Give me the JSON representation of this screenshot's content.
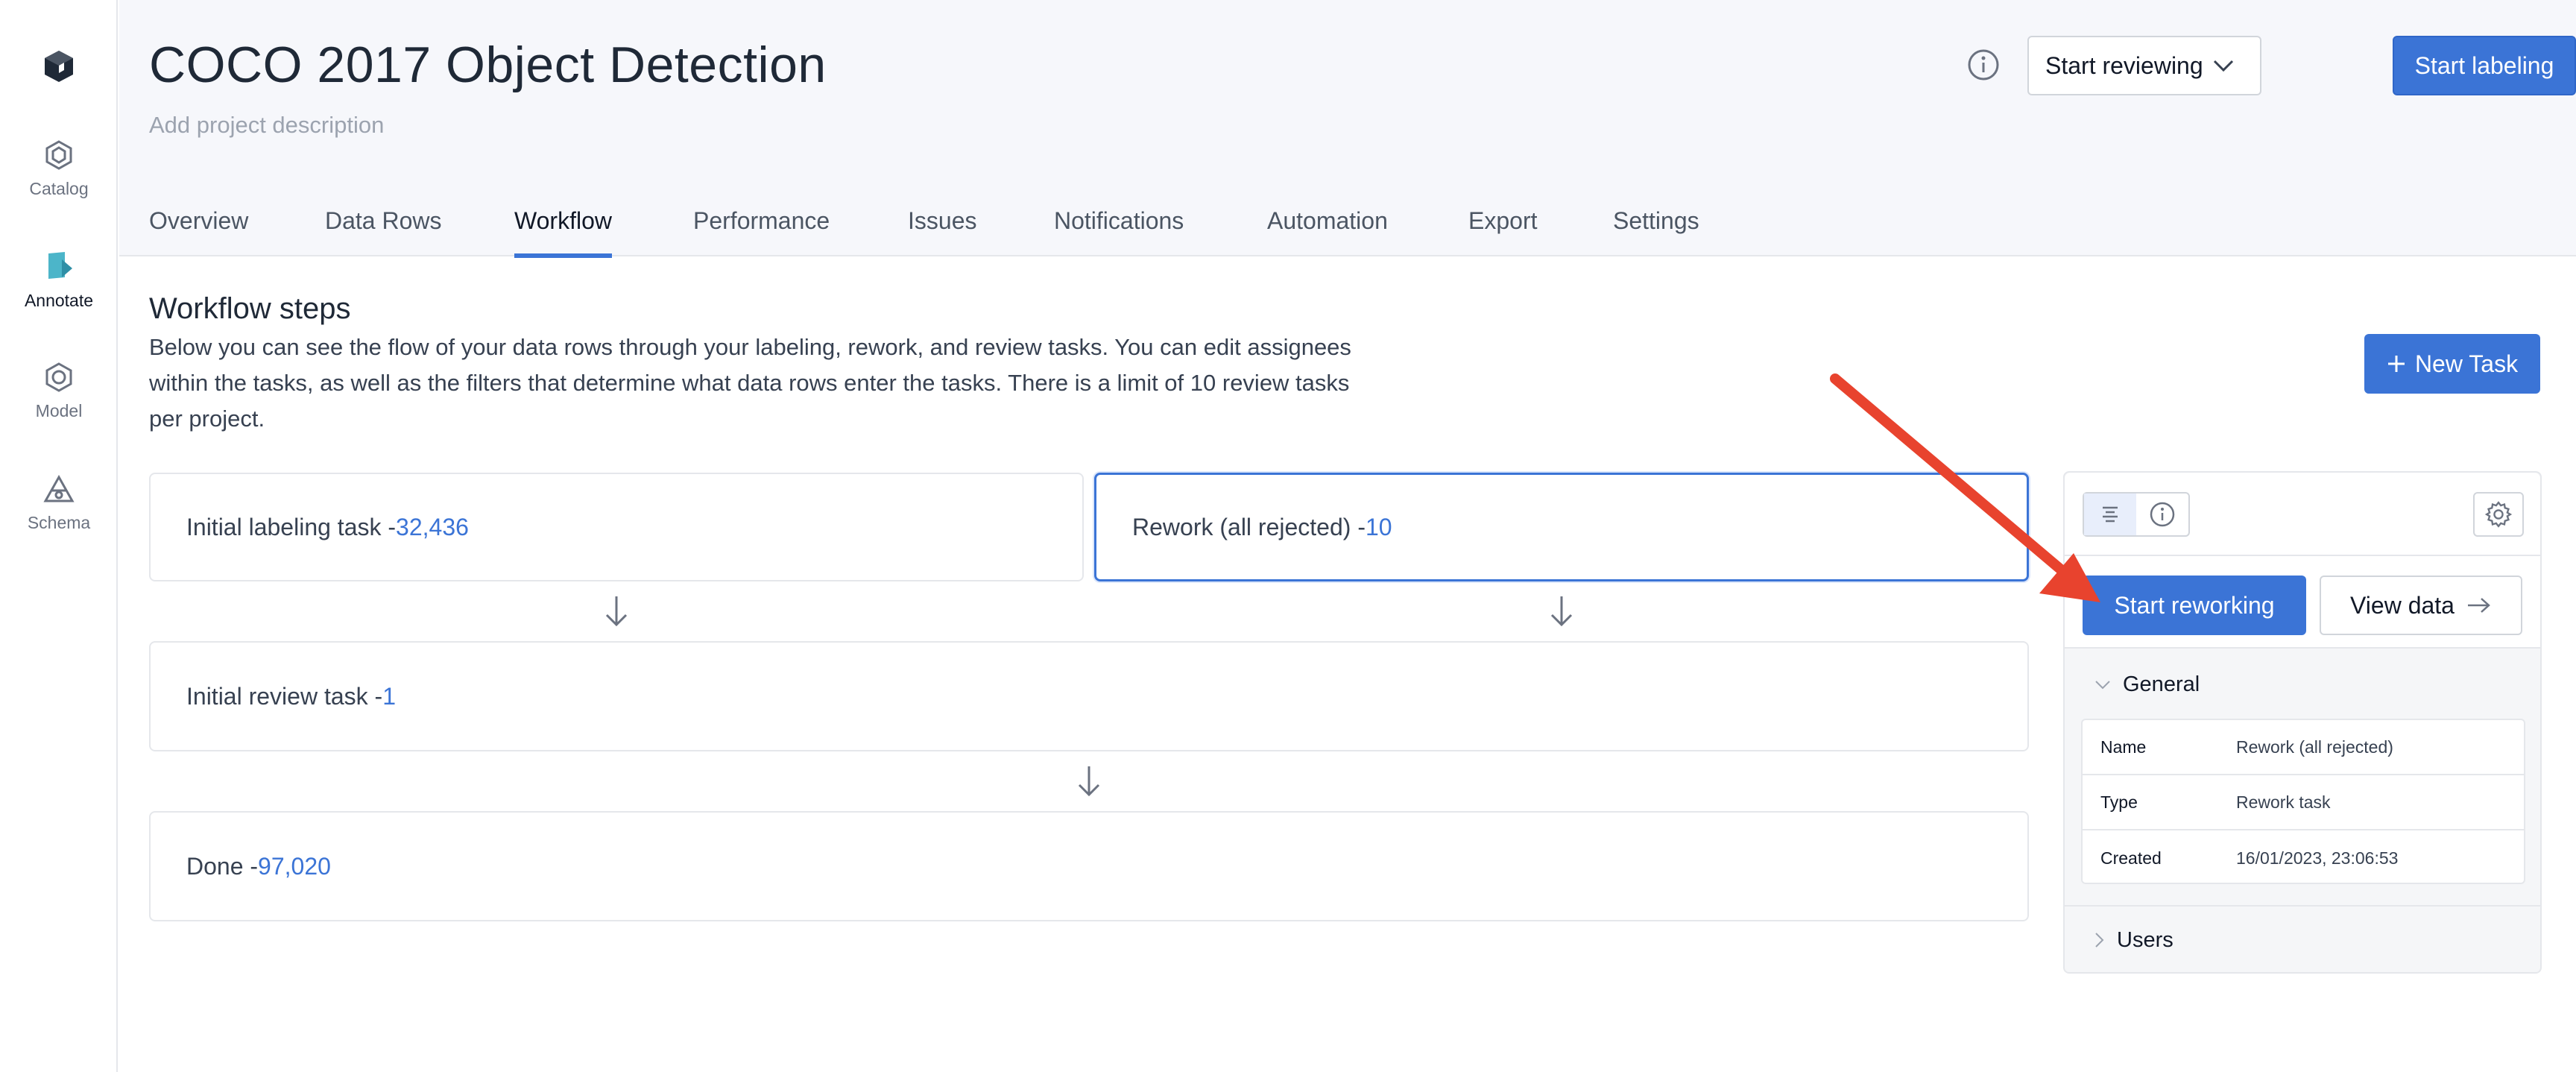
{
  "sidebar": {
    "logo_icon": "labelbox-cube-icon",
    "items": [
      {
        "label": "Catalog",
        "icon": "catalog-icon"
      },
      {
        "label": "Annotate",
        "icon": "annotate-icon"
      },
      {
        "label": "Model",
        "icon": "model-icon"
      },
      {
        "label": "Schema",
        "icon": "schema-icon"
      }
    ],
    "active_item": "Annotate"
  },
  "header": {
    "title": "COCO 2017 Object Detection",
    "description_placeholder": "Add project description",
    "review_select_value": "Start reviewing",
    "start_labeling_label": "Start labeling"
  },
  "tabs": [
    {
      "label": "Overview"
    },
    {
      "label": "Data Rows"
    },
    {
      "label": "Workflow"
    },
    {
      "label": "Performance"
    },
    {
      "label": "Issues"
    },
    {
      "label": "Notifications"
    },
    {
      "label": "Automation"
    },
    {
      "label": "Export"
    },
    {
      "label": "Settings"
    }
  ],
  "active_tab": "Workflow",
  "workflow": {
    "title": "Workflow steps",
    "description": "Below you can see the flow of your data rows through your labeling, rework, and review tasks. You can edit assignees within the tasks, as well as the filters that determine what data rows enter the tasks. There is a limit of 10 review tasks per project.",
    "new_task_label": "New Task",
    "tasks": {
      "initial_labeling": {
        "name": "Initial labeling task - ",
        "count": "32,436"
      },
      "rework": {
        "name": "Rework (all rejected) - ",
        "count": "10"
      },
      "initial_review": {
        "name": "Initial review task - ",
        "count": "1"
      },
      "done": {
        "name": "Done - ",
        "count": "97,020"
      }
    }
  },
  "panel": {
    "start_reworking_label": "Start reworking",
    "view_data_label": "View data",
    "general_label": "General",
    "users_label": "Users",
    "details": [
      {
        "key": "Name",
        "value": "Rework (all rejected)"
      },
      {
        "key": "Type",
        "value": "Rework task"
      },
      {
        "key": "Created",
        "value": "16/01/2023, 23:06:53"
      }
    ]
  },
  "colors": {
    "accent": "#3b74d6",
    "annotation_arrow": "#e8432e"
  }
}
